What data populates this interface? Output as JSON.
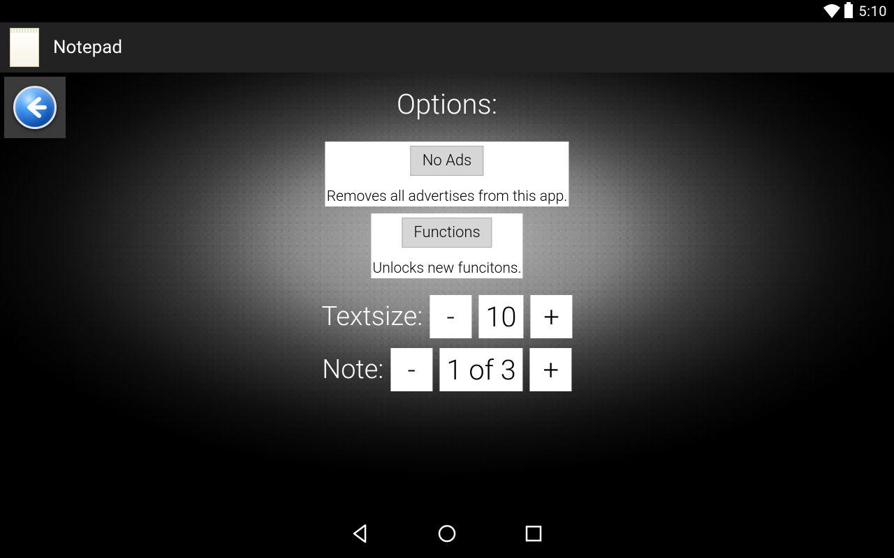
{
  "status": {
    "time": "5:10"
  },
  "header": {
    "title": "Notepad"
  },
  "options": {
    "heading": "Options:",
    "noads": {
      "button": "No Ads",
      "desc": "Removes all advertises from this app."
    },
    "functions": {
      "button": "Functions",
      "desc": "Unlocks new funcitons."
    },
    "textsize": {
      "label": "Textsize:",
      "minus": "-",
      "value": "10",
      "plus": "+"
    },
    "note": {
      "label": "Note:",
      "minus": "-",
      "value": "1 of 3",
      "plus": "+"
    }
  },
  "icons": {
    "back": "back-arrow-icon",
    "wifi": "wifi-icon",
    "battery": "battery-icon",
    "nav_back": "nav-back-icon",
    "nav_home": "nav-home-icon",
    "nav_recents": "nav-recents-icon"
  }
}
